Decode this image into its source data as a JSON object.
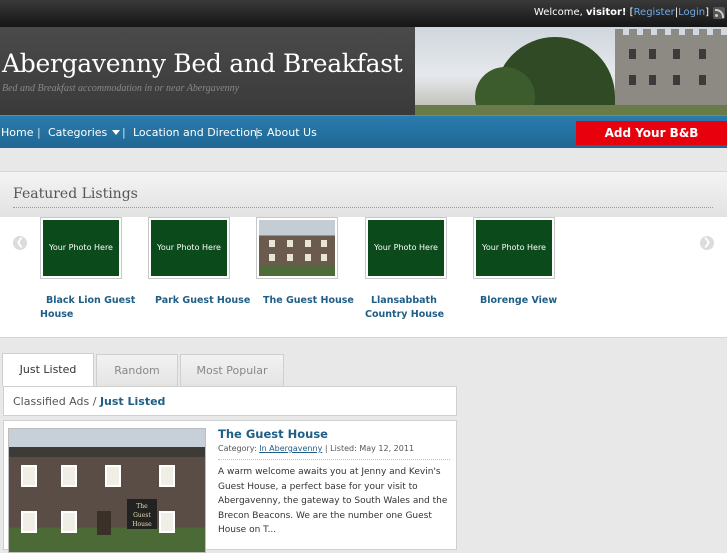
{
  "topbar": {
    "welcome_prefix": "Welcome,",
    "username": "visitor!",
    "bracket_open": "[",
    "register_link": "Register",
    "separator": "|",
    "login_link": "Login",
    "bracket_close": "]",
    "rss_icon": "rss-icon"
  },
  "header": {
    "title": "Abergavenny Bed and Breakfast",
    "tagline": "Bed and Breakfast accommodation in or near Abergavenny"
  },
  "nav": {
    "items": [
      {
        "label": "Home"
      },
      {
        "label": "Categories"
      },
      {
        "label": "Location and Directions"
      },
      {
        "label": "About Us"
      }
    ],
    "separator": "|",
    "add_button": "Add Your B&B"
  },
  "featured": {
    "title": "Featured Listings",
    "placeholder_text": "Your Photo Here",
    "items": [
      {
        "name": "Black Lion Guest House",
        "has_photo": false
      },
      {
        "name": "Park Guest House",
        "has_photo": false
      },
      {
        "name": "The Guest House",
        "has_photo": true
      },
      {
        "name": "Llansabbath Country House",
        "has_photo": false
      },
      {
        "name": "Blorenge View",
        "has_photo": false
      }
    ],
    "prev_icon": "chevron-left-icon",
    "next_icon": "chevron-right-icon"
  },
  "tabs": [
    {
      "label": "Just Listed",
      "active": true
    },
    {
      "label": "Random",
      "active": false
    },
    {
      "label": "Most Popular",
      "active": false
    }
  ],
  "breadcrumb": {
    "root": "Classified Ads",
    "separator": "/",
    "current": "Just Listed"
  },
  "listing": {
    "title": "The Guest House",
    "category_label": "Category:",
    "category": "In Abergavenny",
    "meta_sep": "|",
    "listed": "Listed: May 12, 2011",
    "description": "A warm welcome awaits you at Jenny and Kevin's Guest House, a perfect base for your visit to Abergavenny, the gateway to South Wales and the Brecon Beacons. We are the number one Guest House on T...",
    "sign_text": "The Guest House"
  },
  "colors": {
    "nav_blue": "#1f6794",
    "add_button_red": "#e8000c",
    "link_blue": "#1f5e86",
    "placeholder_green": "#0b4a1a"
  }
}
